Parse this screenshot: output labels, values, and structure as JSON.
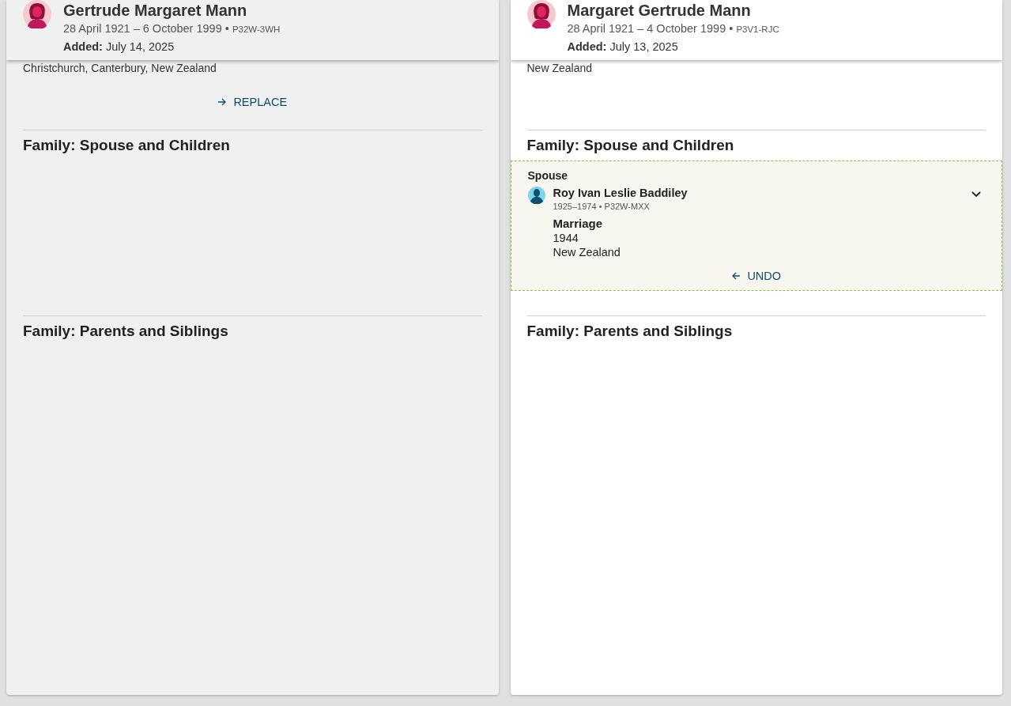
{
  "panels": [
    {
      "dimmed": true,
      "person": {
        "name": "Gertrude Margaret Mann",
        "dates": "28 April 1921 – 6 October 1999",
        "separator": "•",
        "id": "P32W-3WH",
        "added_label": "Added:",
        "added_value": "July 14, 2025"
      },
      "residence": "Christchurch, Canterbury, New Zealand",
      "action": {
        "kind": "replace",
        "label": "REPLACE"
      },
      "sections": [
        {
          "title": "Family: Spouse and Children"
        },
        {
          "title": "Family: Parents and Siblings"
        }
      ]
    },
    {
      "dimmed": false,
      "person": {
        "name": "Margaret Gertrude Mann",
        "dates": "28 April 1921 – 4 October 1999",
        "separator": "•",
        "id": "P3V1-RJC",
        "added_label": "Added:",
        "added_value": "July 13, 2025"
      },
      "residence": "New Zealand",
      "sections": [
        {
          "title": "Family: Spouse and Children",
          "spouse": {
            "label": "Spouse",
            "name": "Roy Ivan Leslie Baddiley",
            "dates": "1925–1974",
            "separator": "•",
            "id": "P32W-MXX",
            "expanded": true,
            "event_title": "Marriage",
            "event_date": "1944",
            "event_place": "New Zealand",
            "action": {
              "kind": "undo",
              "label": "UNDO"
            }
          }
        },
        {
          "title": "Family: Parents and Siblings"
        }
      ]
    }
  ]
}
